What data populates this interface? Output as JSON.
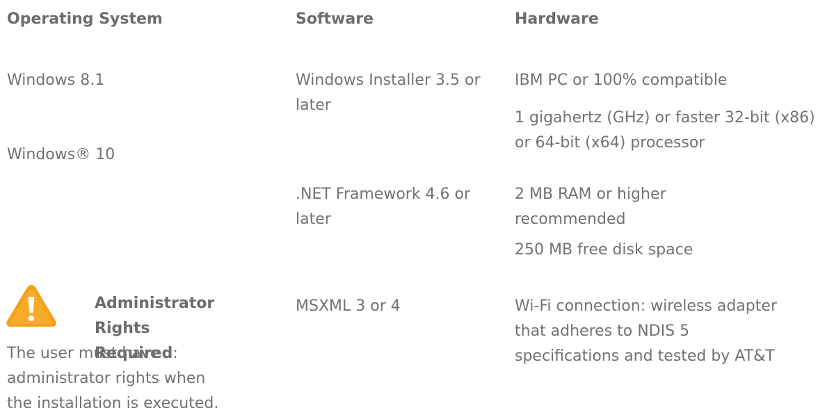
{
  "columns": {
    "os": {
      "header": "Operating System",
      "items": [
        "Windows 8.1",
        "Windows® 10"
      ]
    },
    "software": {
      "header": "Software",
      "items": [
        "Windows Installer 3.5 or later",
        ".NET Framework 4.6 or later",
        "MSXML 3 or 4"
      ]
    },
    "hardware": {
      "header": "Hardware",
      "items": [
        "IBM PC or 100% compatible",
        "1 gigahertz (GHz) or faster 32-bit (x86) or 64-bit (x64) processor",
        "2 MB RAM or higher recommended",
        "250 MB free disk space",
        "Wi-Fi connection: wireless adapter that adheres to NDIS 5 specifications and tested by AT&T"
      ]
    }
  },
  "note": {
    "icon": "warning-icon",
    "icon_color": "#F7A21B",
    "title": "Administrator Rights Required",
    "title_suffix": ":",
    "body": "The user must have administrator rights when the installation is executed."
  }
}
